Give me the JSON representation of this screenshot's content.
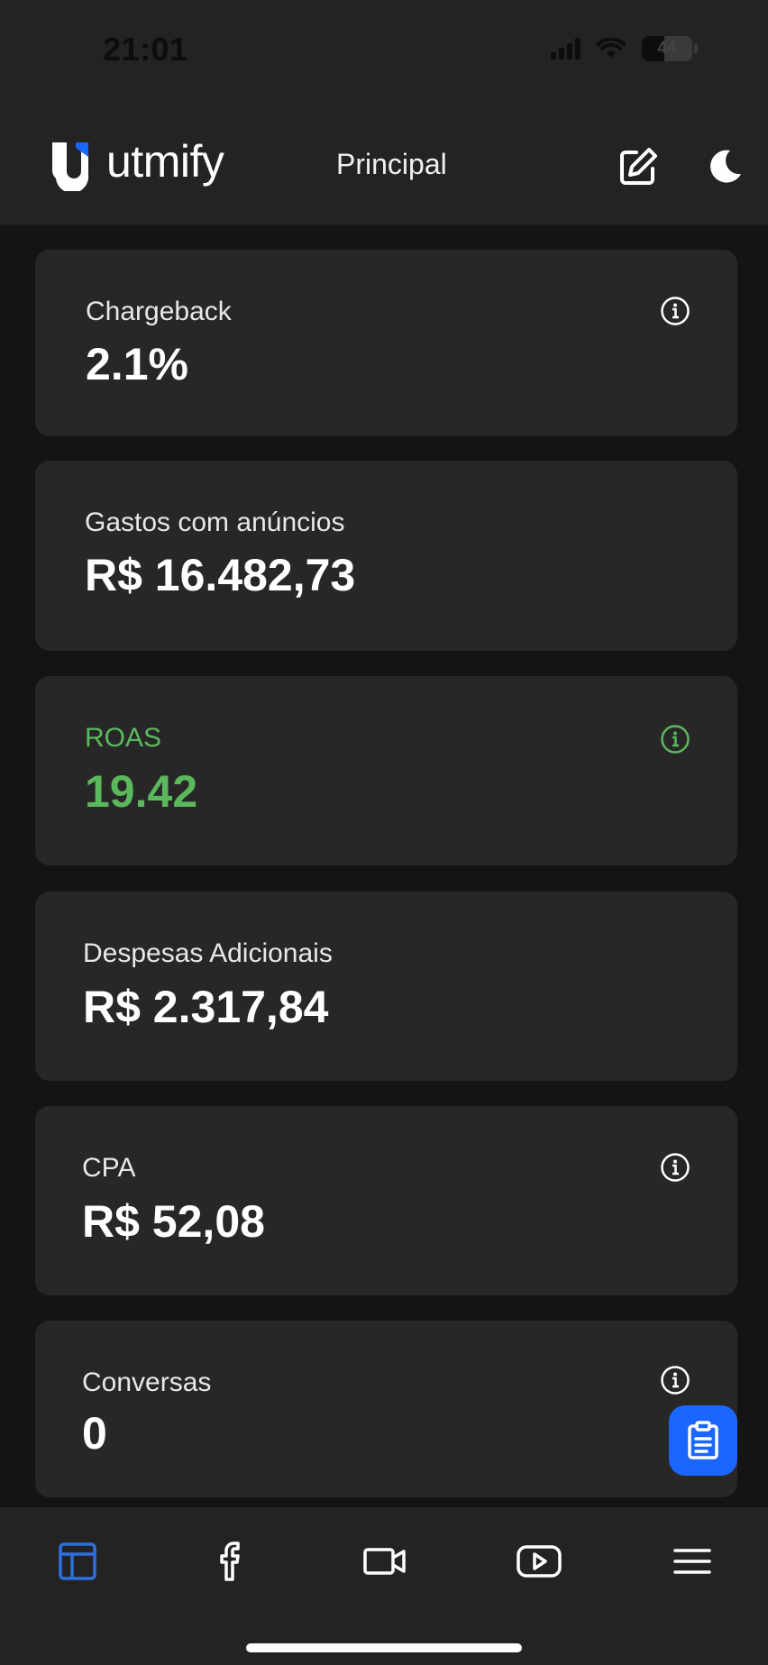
{
  "status_bar": {
    "time": "21:01",
    "battery_level": "44",
    "icons": [
      "cellular-signal-icon",
      "wifi-icon",
      "battery-icon"
    ]
  },
  "header": {
    "logo_text": "utmify",
    "page_title": "Principal",
    "icons": [
      "edit-icon",
      "dark-mode-moon-icon"
    ]
  },
  "cards": [
    {
      "label": "Chargeback",
      "value": "2.1%",
      "info": true
    },
    {
      "label": "Gastos com anúncios",
      "value": "R$ 16.482,73",
      "info": false
    },
    {
      "label": "ROAS",
      "value": "19.42",
      "info": true,
      "color": "#5cb85c"
    },
    {
      "label": "Despesas Adicionais",
      "value": "R$ 2.317,84",
      "info": false
    },
    {
      "label": "CPA",
      "value": "R$ 52,08",
      "info": true
    },
    {
      "label": "Conversas",
      "value": "0",
      "info": true
    }
  ],
  "fab": {
    "icon": "clipboard-icon"
  },
  "bottom_nav": {
    "items": [
      "dashboard-layout-icon",
      "facebook-icon",
      "video-camera-icon",
      "youtube-icon",
      "hamburger-menu-icon"
    ],
    "active": "dashboard-layout-icon"
  },
  "colors": {
    "accent": "#1a66ff",
    "positive": "#5cb85c",
    "nav_active": "#2f6fdc",
    "card_bg": "#272728",
    "page_bg": "#141414"
  }
}
